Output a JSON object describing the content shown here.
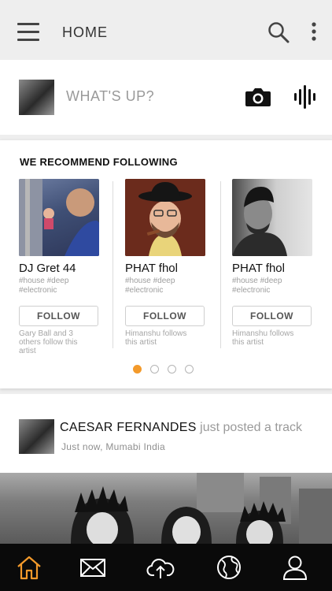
{
  "header": {
    "title": "HOME",
    "menu_icon": "hamburger-menu-icon",
    "search_icon": "search-icon",
    "more_icon": "more-vertical-icon"
  },
  "composer": {
    "prompt": "WHAT'S UP?",
    "camera_icon": "camera-icon",
    "audio_icon": "audio-wave-icon"
  },
  "recommend": {
    "heading": "WE RECOMMEND FOLLOWING",
    "artists": [
      {
        "name": "DJ Gret 44",
        "tags": "#house #deep #electronic",
        "follow_label": "FOLLOW",
        "social": "Gary Ball and 3 others follow this artist"
      },
      {
        "name": "PHAT fhol",
        "tags": "#house #deep #electronic",
        "follow_label": "FOLLOW",
        "social": "Himanshu follows this artist"
      },
      {
        "name": "PHAT fhol",
        "tags": "#house #deep #electronic",
        "follow_label": "FOLLOW",
        "social": "Himanshu follows this artist"
      }
    ],
    "page_indicator": {
      "pages": 4,
      "active": 1
    }
  },
  "feed": {
    "author": "CAESAR FERNANDES",
    "action": " just posted a track",
    "meta": "Just now, Mumabi India"
  },
  "colors": {
    "accent": "#f39a2b",
    "nav_background": "#0a0a0a",
    "nav_icon": "#ffffff"
  },
  "bottom_nav": [
    {
      "icon": "home-icon",
      "active": true
    },
    {
      "icon": "mail-icon",
      "active": false
    },
    {
      "icon": "cloud-upload-icon",
      "active": false
    },
    {
      "icon": "globe-icon",
      "active": false
    },
    {
      "icon": "profile-icon",
      "active": false
    }
  ]
}
